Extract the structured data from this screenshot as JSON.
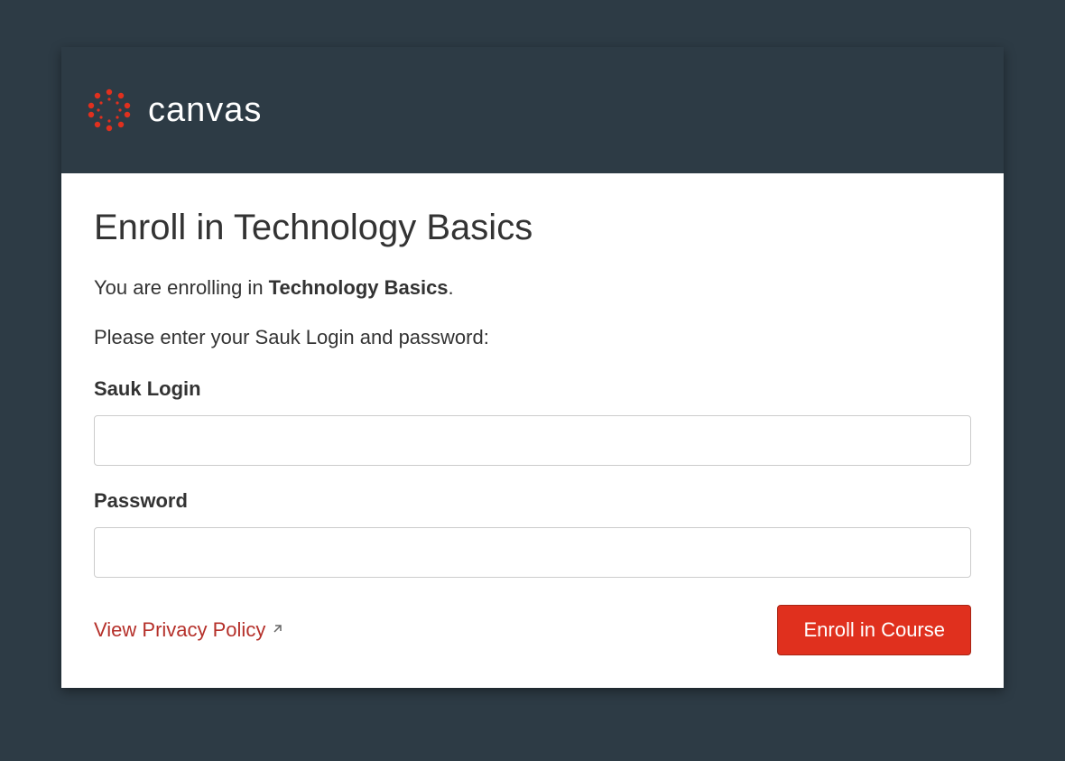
{
  "brand": {
    "logo_text": "canvas"
  },
  "page": {
    "title": "Enroll in Technology Basics",
    "enroll_prefix": "You are enrolling in ",
    "course_name": "Technology Basics",
    "enroll_suffix": ".",
    "instructions": "Please enter your Sauk Login and password:"
  },
  "form": {
    "login_label": "Sauk Login",
    "login_value": "",
    "password_label": "Password",
    "password_value": ""
  },
  "footer": {
    "privacy_link": "View Privacy Policy",
    "submit_label": "Enroll in Course"
  },
  "colors": {
    "background": "#2d3b45",
    "accent": "#e0301e",
    "link": "#b5302a"
  }
}
